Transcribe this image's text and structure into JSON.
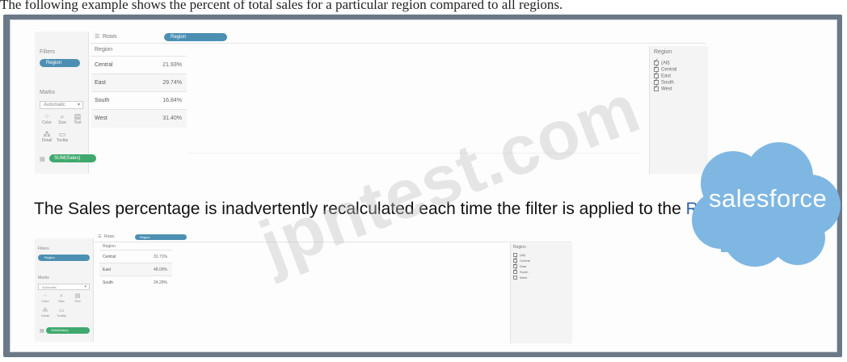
{
  "header": {
    "text": "The following example shows the percent of total sales for a particular region compared to all regions."
  },
  "caption": {
    "prefix": "The Sales percentage is inadvertently recalculated each time the filter is applied to the ",
    "highlight": "Region."
  },
  "watermark": {
    "text": "jpntest.com"
  },
  "brand": {
    "logo_text": "salesforce",
    "cloud_color": "#7fb7e3"
  },
  "top_view": {
    "rows_label": "Rows",
    "rows_pill": "Region",
    "filters_title": "Filters",
    "filter_pill": "Region",
    "marks_title": "Marks",
    "marks_type": "Automatic",
    "mark_buttons": [
      "Color",
      "Size",
      "Text",
      "Detail",
      "Tooltip"
    ],
    "measure_pill": "SUM(Sales)",
    "table_header": "Region",
    "rows": [
      {
        "region": "Central",
        "value": "21.93%"
      },
      {
        "region": "East",
        "value": "29.74%"
      },
      {
        "region": "South",
        "value": "16.84%"
      },
      {
        "region": "West",
        "value": "31.40%"
      }
    ],
    "legend_title": "Region",
    "legend_items": [
      "(All)",
      "Central",
      "East",
      "South",
      "West"
    ]
  },
  "bottom_view": {
    "rows_label": "Rows",
    "rows_pill": "Region",
    "filters_title": "Filters",
    "filter_pill": "Region",
    "marks_title": "Marks",
    "marks_type": "Automatic",
    "mark_buttons": [
      "Color",
      "Size",
      "Text",
      "Detail",
      "Tooltip"
    ],
    "measure_pill": "SUM(Sales)",
    "table_header": "Region",
    "rows": [
      {
        "region": "Central",
        "value": "31.71%"
      },
      {
        "region": "East",
        "value": "48.00%"
      },
      {
        "region": "South",
        "value": "24.29%"
      }
    ],
    "legend_title": "Region",
    "legend_items": [
      {
        "label": "(All)",
        "checked": false
      },
      {
        "label": "Central",
        "checked": true
      },
      {
        "label": "East",
        "checked": true
      },
      {
        "label": "South",
        "checked": true
      },
      {
        "label": "West",
        "checked": false
      }
    ]
  }
}
